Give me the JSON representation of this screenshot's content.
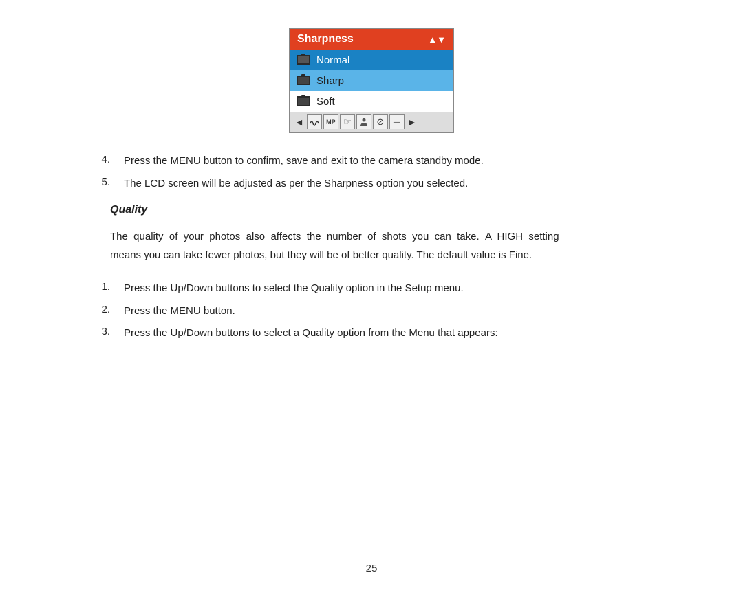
{
  "widget": {
    "title": "Sharpness",
    "items": [
      {
        "label": "Normal",
        "state": "selected"
      },
      {
        "label": "Sharp",
        "state": "highlighted"
      },
      {
        "label": "Soft",
        "state": "normal"
      }
    ],
    "toolbar_icons": [
      "▲▼",
      "∿",
      "MP",
      "☞",
      "☻",
      "⊘",
      "▬"
    ],
    "arrows": [
      "◄",
      "►"
    ]
  },
  "steps_above": [
    {
      "number": "4.",
      "text": "Press the MENU button to confirm, save and exit to the camera standby mode."
    },
    {
      "number": "5.",
      "text": "The LCD screen will be adjusted as per the Sharpness option you selected."
    }
  ],
  "section": {
    "title": "Quality",
    "paragraph": "The  quality  of  your  photos  also  affects  the  number  of  shots  you  can  take.  A  HIGH  setting means you can take fewer photos, but they will be of better quality. The default value is Fine.",
    "steps": [
      {
        "number": "1.",
        "text": "Press the Up/Down buttons to select the Quality option in the Setup menu."
      },
      {
        "number": "2.",
        "text": "Press the MENU button."
      },
      {
        "number": "3.",
        "text": "Press the Up/Down buttons to select a Quality option from the Menu that appears:"
      }
    ]
  },
  "page_number": "25"
}
